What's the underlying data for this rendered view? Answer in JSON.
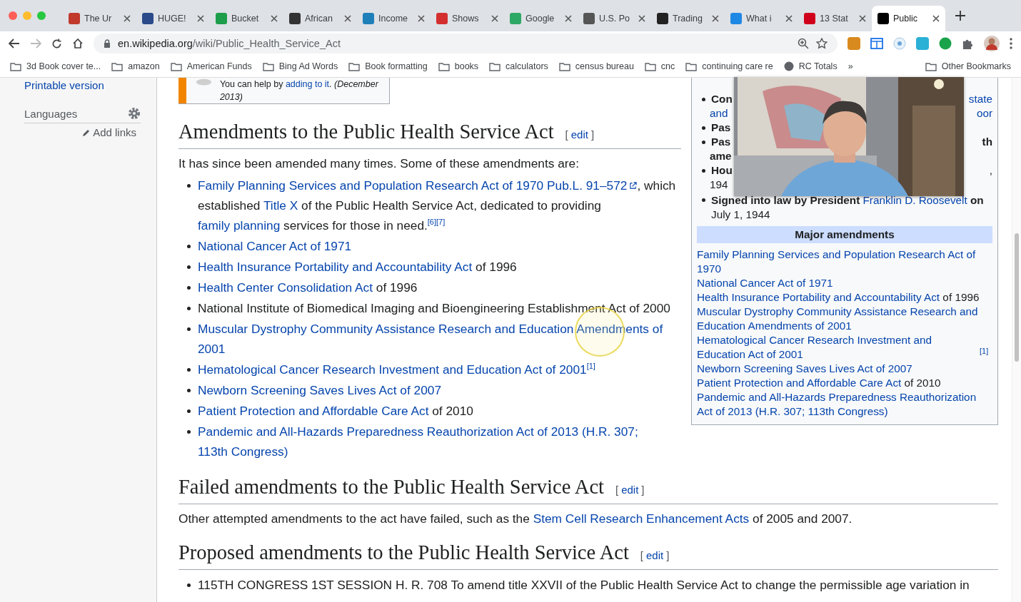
{
  "browser": {
    "tabs": [
      {
        "title": "The Ur",
        "color": "#c0392b",
        "selected": false
      },
      {
        "title": "HUGE!",
        "color": "#2b4a8a",
        "selected": false
      },
      {
        "title": "Bucket",
        "color": "#1e9e4a",
        "selected": false
      },
      {
        "title": "African",
        "color": "#333333",
        "selected": false
      },
      {
        "title": "Income",
        "color": "#1f7fb8",
        "selected": false
      },
      {
        "title": "Shows",
        "color": "#d32f2f",
        "selected": false
      },
      {
        "title": "Google",
        "color": "#2ea865",
        "selected": false
      },
      {
        "title": "U.S. Po",
        "color": "#555555",
        "selected": false
      },
      {
        "title": "Trading",
        "color": "#222222",
        "selected": false
      },
      {
        "title": "What i",
        "color": "#1e88e5",
        "selected": false
      },
      {
        "title": "13 Stat",
        "color": "#d0021b",
        "selected": false
      },
      {
        "title": "Public",
        "color": "#000000",
        "selected": true
      }
    ],
    "url": {
      "host": "en.wikipedia.org",
      "path": "/wiki/Public_Health_Service_Act"
    },
    "bookmarks": [
      {
        "label": "3d Book cover te...",
        "kind": "folder"
      },
      {
        "label": "amazon",
        "kind": "folder"
      },
      {
        "label": "American Funds",
        "kind": "folder"
      },
      {
        "label": "Bing Ad Words",
        "kind": "folder"
      },
      {
        "label": "Book formatting",
        "kind": "folder"
      },
      {
        "label": "books",
        "kind": "folder"
      },
      {
        "label": "calculators",
        "kind": "folder"
      },
      {
        "label": "census bureau",
        "kind": "folder"
      },
      {
        "label": "cnc",
        "kind": "folder"
      },
      {
        "label": "continuing care re",
        "kind": "folder"
      },
      {
        "label": "RC Totals",
        "kind": "site"
      }
    ],
    "more_bookmarks": "»",
    "other_bookmarks": "Other Bookmarks"
  },
  "sidebar": {
    "printable": "Printable version",
    "languages": "Languages",
    "add_links": "Add links"
  },
  "notice": [
    {
      "kind": "text",
      "text": "You can help by "
    },
    {
      "kind": "link",
      "text": "adding to it"
    },
    {
      "kind": "text",
      "text": ". "
    },
    {
      "kind": "italic",
      "text": "(December 2013)"
    }
  ],
  "sections": [
    {
      "title": "Amendments to the Public Health Service Act",
      "edit": [
        "[",
        "edit",
        "]"
      ],
      "paragraph": [
        {
          "kind": "text",
          "text": "It has since been amended many times. Some of these amendments are:"
        }
      ],
      "items": [
        [
          {
            "kind": "link",
            "text": "Family Planning Services and Population Research Act of 1970"
          },
          {
            "kind": "ext",
            "text": "Pub.L. 91–572"
          },
          {
            "kind": "text",
            "text": ", which established "
          },
          {
            "kind": "link",
            "text": "Title X"
          },
          {
            "kind": "text",
            "text": " of the Public Health Service Act, dedicated to providing "
          },
          {
            "kind": "link",
            "text": "family planning"
          },
          {
            "kind": "text",
            "text": " services for those in need."
          },
          {
            "kind": "ref",
            "text": "[6][7]"
          }
        ],
        [
          {
            "kind": "link",
            "text": "National Cancer Act of 1971"
          }
        ],
        [
          {
            "kind": "link",
            "text": "Health Insurance Portability and Accountability Act"
          },
          {
            "kind": "text",
            "text": " of 1996"
          }
        ],
        [
          {
            "kind": "link",
            "text": "Health Center Consolidation Act"
          },
          {
            "kind": "text",
            "text": " of 1996"
          }
        ],
        [
          {
            "kind": "text",
            "text": "National Institute of Biomedical Imaging and Bioengineering Establishment Act of 2000"
          }
        ],
        [
          {
            "kind": "link",
            "text": "Muscular Dystrophy Community Assistance Research and Education Amendments of 2001"
          }
        ],
        [
          {
            "kind": "link",
            "text": "Hematological Cancer Research Investment and Education Act of 2001"
          },
          {
            "kind": "ref",
            "text": "[1]"
          }
        ],
        [
          {
            "kind": "link",
            "text": "Newborn Screening Saves Lives Act of 2007"
          }
        ],
        [
          {
            "kind": "link",
            "text": "Patient Protection and Affordable Care Act"
          },
          {
            "kind": "text",
            "text": " of 2010"
          }
        ],
        [
          {
            "kind": "link",
            "text": "Pandemic and All-Hazards Preparedness Reauthorization Act of 2013 (H.R. 307; 113th Congress)"
          }
        ]
      ]
    },
    {
      "title": "Failed amendments to the Public Health Service Act",
      "edit": [
        "[",
        "edit",
        "]"
      ],
      "paragraph": [
        {
          "kind": "text",
          "text": "Other attempted amendments to the act have failed, such as the "
        },
        {
          "kind": "link",
          "text": "Stem Cell Research Enhancement Acts"
        },
        {
          "kind": "text",
          "text": " of 2005 and 2007."
        }
      ]
    },
    {
      "title": "Proposed amendments to the Public Health Service Act",
      "edit": [
        "[",
        "edit",
        "]"
      ],
      "items": [
        [
          {
            "kind": "text",
            "text": "115TH CONGRESS 1ST SESSION H. R. 708 To amend title XXVII of the Public Health Service Act to change the permissible age variation in"
          }
        ]
      ]
    }
  ],
  "infobox": {
    "fragments": [
      {
        "bullet": true,
        "left": {
          "kind": "bold",
          "text": "Con"
        },
        "right": {
          "kind": "link",
          "text": "state"
        }
      },
      {
        "bullet": false,
        "left": {
          "kind": "link",
          "text": "and"
        },
        "right": {
          "kind": "link",
          "text": "oor"
        }
      },
      {
        "bullet": true,
        "left": {
          "kind": "bold",
          "text": "Pas"
        }
      },
      {
        "bullet": true,
        "left": {
          "kind": "bold",
          "text": "Pas"
        },
        "right": {
          "kind": "bold",
          "text": "th"
        }
      },
      {
        "bullet": false,
        "left": {
          "kind": "bold",
          "text": "ame"
        }
      },
      {
        "bullet": true,
        "left": {
          "kind": "bold",
          "text": "Hou"
        },
        "right": {
          "kind": "text",
          "text": ","
        }
      },
      {
        "bullet": false,
        "left": {
          "kind": "text",
          "text": "194"
        }
      }
    ],
    "signed": [
      {
        "kind": "bold",
        "text": "Signed into law by President "
      },
      {
        "kind": "link",
        "text": "Franklin D. Roosevelt"
      },
      {
        "kind": "bold",
        "text": " on"
      },
      {
        "kind": "text",
        "text": " July 1, 1944"
      }
    ],
    "header": "Major amendments",
    "amendments": [
      [
        {
          "kind": "link",
          "text": "Family Planning Services and Population Research Act of 1970"
        }
      ],
      [
        {
          "kind": "link",
          "text": "National Cancer Act of 1971"
        }
      ],
      [
        {
          "kind": "link",
          "text": "Health Insurance Portability and Accountability Act"
        },
        {
          "kind": "text",
          "text": " of 1996"
        }
      ],
      [
        {
          "kind": "link",
          "text": "Muscular Dystrophy Community Assistance Research and Education Amendments of 2001"
        }
      ],
      [
        {
          "kind": "link",
          "text": "Hematological Cancer Research Investment and Education Act of 2001"
        },
        {
          "kind": "ref",
          "text": "[1]"
        }
      ],
      [
        {
          "kind": "link",
          "text": "Newborn Screening Saves Lives Act of 2007"
        }
      ],
      [
        {
          "kind": "link",
          "text": "Patient Protection and Affordable Care Act"
        },
        {
          "kind": "text",
          "text": " of 2010"
        }
      ],
      [
        {
          "kind": "link",
          "text": "Pandemic and All-Hazards Preparedness Reauthorization Act of 2013 (H.R. 307; 113th Congress)"
        }
      ]
    ]
  }
}
